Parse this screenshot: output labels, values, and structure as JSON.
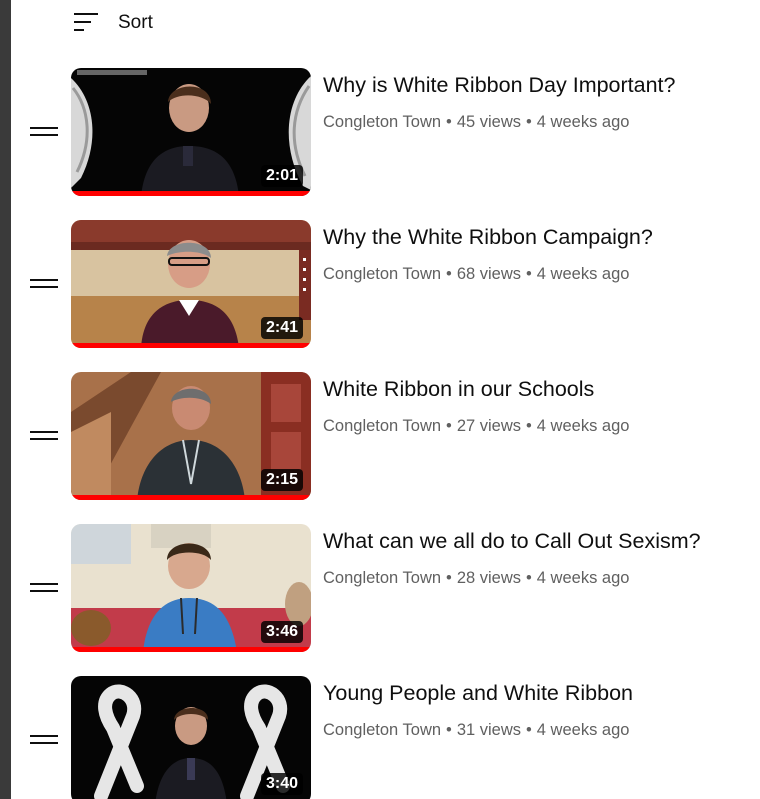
{
  "sort": {
    "label": "Sort",
    "icon": "sort-icon"
  },
  "separator": "•",
  "colors": {
    "title": "#0f0f0f",
    "meta": "#606060",
    "progress": "#ff0000",
    "duration_bg": "#000000"
  },
  "videos": [
    {
      "title": "Why is White Ribbon Day Important?",
      "channel": "Congleton Town",
      "views": "45 views",
      "age": "4 weeks ago",
      "duration": "2:01",
      "watched_fraction": 1.0
    },
    {
      "title": "Why the White Ribbon Campaign?",
      "channel": "Congleton Town",
      "views": "68 views",
      "age": "4 weeks ago",
      "duration": "2:41",
      "watched_fraction": 1.0
    },
    {
      "title": "White Ribbon in our Schools",
      "channel": "Congleton Town",
      "views": "27 views",
      "age": "4 weeks ago",
      "duration": "2:15",
      "watched_fraction": 1.0
    },
    {
      "title": "What can we all do to Call Out Sexism?",
      "channel": "Congleton Town",
      "views": "28 views",
      "age": "4 weeks ago",
      "duration": "3:46",
      "watched_fraction": 1.0
    },
    {
      "title": "Young People and White Ribbon",
      "channel": "Congleton Town",
      "views": "31 views",
      "age": "4 weeks ago",
      "duration": "3:40",
      "watched_fraction": 1.0
    }
  ]
}
